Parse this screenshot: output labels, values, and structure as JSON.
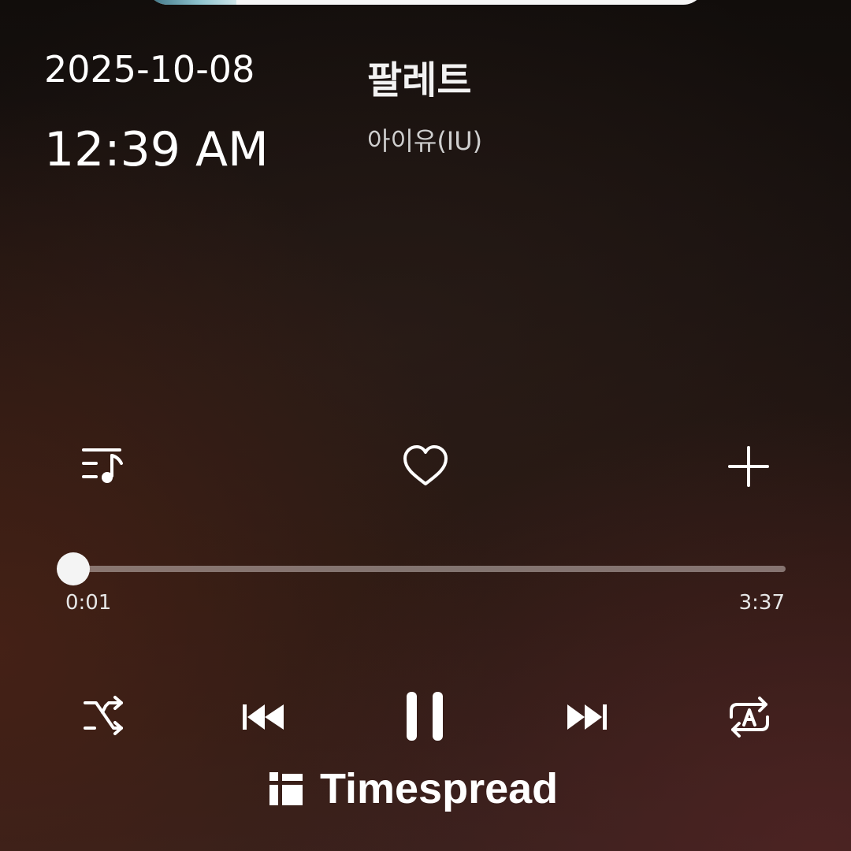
{
  "status": {
    "date": "2025-10-08",
    "time": "12:39 AM"
  },
  "track": {
    "title": "팔레트",
    "artist": "아이유(IU)"
  },
  "actions": {
    "playlist_icon": "playlist-music-icon",
    "like_icon": "heart-outline-icon",
    "add_icon": "plus-icon"
  },
  "playback": {
    "elapsed": "0:01",
    "duration": "3:37",
    "progress_fraction": 0.005
  },
  "controls": {
    "shuffle_icon": "shuffle-icon",
    "previous_icon": "skip-previous-icon",
    "play_pause_icon": "pause-icon",
    "next_icon": "skip-next-icon",
    "repeat_icon": "repeat-ab-icon"
  },
  "watermark": {
    "brand": "Timespread"
  },
  "colors": {
    "foreground": "#ffffff",
    "track_bar": "#a8a09e",
    "background_dark": "#110d0b",
    "background_warm": "#34201c"
  }
}
